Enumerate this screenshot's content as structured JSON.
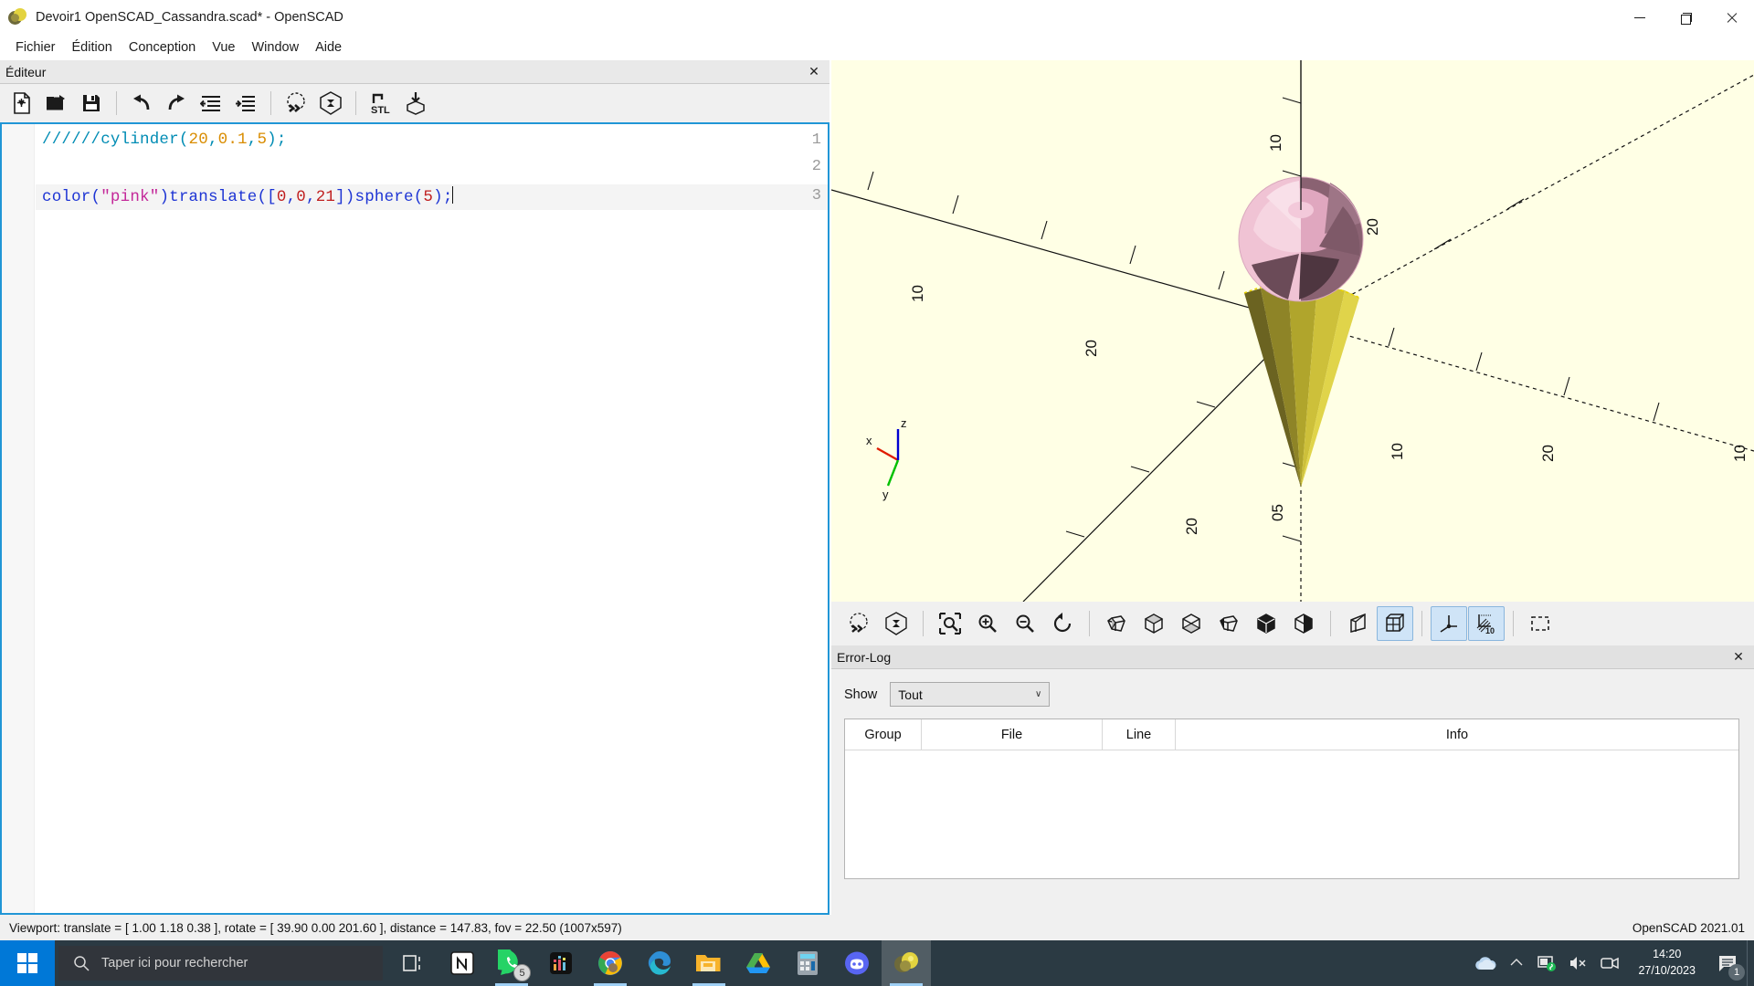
{
  "window": {
    "title": "Devoir1 OpenSCAD_Cassandra.scad* - OpenSCAD",
    "app_icon": "openscad-logo-icon",
    "controls": {
      "minimize": "minimize-button",
      "maximize": "maximize-button",
      "close": "close-button"
    }
  },
  "menubar": {
    "items": [
      {
        "label": "Fichier"
      },
      {
        "label": "Édition"
      },
      {
        "label": "Conception"
      },
      {
        "label": "Vue"
      },
      {
        "label": "Window"
      },
      {
        "label": "Aide"
      }
    ]
  },
  "editor": {
    "dock_title": "Éditeur",
    "close_label": "✕",
    "toolbar": [
      {
        "name": "new-file-icon",
        "tooltip": "Nouveau"
      },
      {
        "name": "open-file-icon",
        "tooltip": "Ouvrir"
      },
      {
        "name": "save-file-icon",
        "tooltip": "Enregistrer"
      },
      {
        "name": "undo-icon",
        "tooltip": "Annuler"
      },
      {
        "name": "redo-icon",
        "tooltip": "Rétablir"
      },
      {
        "name": "unindent-icon",
        "tooltip": "Désindenter"
      },
      {
        "name": "indent-icon",
        "tooltip": "Indenter"
      },
      {
        "name": "preview-icon",
        "tooltip": "Prévisualiser"
      },
      {
        "name": "render-icon",
        "tooltip": "Rendu"
      },
      {
        "name": "export-stl-icon",
        "tooltip": "Exporter STL",
        "text": "STL"
      },
      {
        "name": "export-image-icon",
        "tooltip": "Exporter image"
      }
    ],
    "lines": [
      {
        "number": "1",
        "text": "//////cylinder(20,0.1,5);"
      },
      {
        "number": "2",
        "text": ""
      },
      {
        "number": "3",
        "text": "color(\"pink\")translate([0,0,21])sphere(5);"
      }
    ],
    "line1_tokens": [
      {
        "t": "//////cylinder(",
        "c": "tok-comment"
      },
      {
        "t": "20",
        "c": "tok-num-c"
      },
      {
        "t": ",",
        "c": "tok-comment"
      },
      {
        "t": "0.1",
        "c": "tok-num-c"
      },
      {
        "t": ",",
        "c": "tok-comment"
      },
      {
        "t": "5",
        "c": "tok-num-c"
      },
      {
        "t": ");",
        "c": "tok-comment"
      }
    ],
    "line3_tokens": [
      {
        "t": "color",
        "c": "tok-fn"
      },
      {
        "t": "(",
        "c": "tok-punct"
      },
      {
        "t": "\"pink\"",
        "c": "tok-str"
      },
      {
        "t": ")",
        "c": "tok-punct"
      },
      {
        "t": "translate",
        "c": "tok-fn"
      },
      {
        "t": "([",
        "c": "tok-punct"
      },
      {
        "t": "0",
        "c": "tok-num"
      },
      {
        "t": ",",
        "c": "tok-punct"
      },
      {
        "t": "0",
        "c": "tok-num"
      },
      {
        "t": ",",
        "c": "tok-punct"
      },
      {
        "t": "21",
        "c": "tok-num"
      },
      {
        "t": "])",
        "c": "tok-punct"
      },
      {
        "t": "sphere",
        "c": "tok-fn"
      },
      {
        "t": "(",
        "c": "tok-punct"
      },
      {
        "t": "5",
        "c": "tok-num"
      },
      {
        "t": ");",
        "c": "tok-punct"
      }
    ],
    "cursor_line": "3"
  },
  "viewport": {
    "background_color": "#ffffe5",
    "model": {
      "cone_color": "#c3b42e",
      "sphere_color": "#f0b8cf",
      "description": "ice-cream cone: yellow cone apex-down with pink faceted sphere on top"
    },
    "axis_indicator": {
      "x_label": "x",
      "y_label": "y",
      "z_label": "z",
      "x_color": "#e01b00",
      "y_color": "#00c000",
      "z_color": "#0000d0"
    },
    "axis_tick_labels": [
      "10",
      "20",
      "10",
      "20",
      "10",
      "20",
      "10",
      "20",
      "10",
      "10",
      "10"
    ],
    "toolbar": [
      {
        "name": "preview-icon",
        "active": false
      },
      {
        "name": "render-icon",
        "active": false
      },
      {
        "name": "zoom-fit-icon",
        "active": false
      },
      {
        "name": "zoom-in-icon",
        "active": false
      },
      {
        "name": "zoom-out-icon",
        "active": false
      },
      {
        "name": "reset-view-icon",
        "active": false
      },
      {
        "name": "view-right-icon",
        "active": false
      },
      {
        "name": "view-top-icon",
        "active": false
      },
      {
        "name": "view-bottom-icon",
        "active": false
      },
      {
        "name": "view-left-icon",
        "active": false
      },
      {
        "name": "view-front-icon",
        "active": false
      },
      {
        "name": "view-back-icon",
        "active": false
      },
      {
        "name": "perspective-icon",
        "active": false
      },
      {
        "name": "orthogonal-icon",
        "active": true
      },
      {
        "name": "show-axes-icon",
        "active": true
      },
      {
        "name": "show-scale-icon",
        "active": true,
        "text": "10"
      },
      {
        "name": "show-edges-icon",
        "active": false
      }
    ]
  },
  "errorlog": {
    "dock_title": "Error-Log",
    "close_label": "✕",
    "show_label": "Show",
    "filter_value": "Tout",
    "filter_chevron": "∨",
    "columns": [
      "Group",
      "File",
      "Line",
      "Info"
    ],
    "rows": []
  },
  "statusbar": {
    "viewport_info": "Viewport: translate = [ 1.00 1.18 0.38 ], rotate = [ 39.90 0.00 201.60 ], distance = 147.83, fov = 22.50 (1007x597)",
    "version": "OpenSCAD 2021.01"
  },
  "taskbar": {
    "start_label": "start-button",
    "search": {
      "placeholder": "Taper ici pour rechercher",
      "icon": "search-icon"
    },
    "apps": [
      {
        "name": "task-view-icon",
        "label": "Task View"
      },
      {
        "name": "notion-icon",
        "label": "Notion"
      },
      {
        "name": "whatsapp-icon",
        "label": "WhatsApp",
        "badge": "5"
      },
      {
        "name": "spotify-icon",
        "label": "Spotify"
      },
      {
        "name": "chrome-icon",
        "label": "Google Chrome"
      },
      {
        "name": "edge-icon",
        "label": "Microsoft Edge"
      },
      {
        "name": "file-explorer-icon",
        "label": "Explorateur de fichiers"
      },
      {
        "name": "google-drive-icon",
        "label": "Google Drive"
      },
      {
        "name": "calculator-icon",
        "label": "Calculatrice"
      },
      {
        "name": "discord-icon",
        "label": "Discord"
      },
      {
        "name": "openscad-icon",
        "label": "OpenSCAD"
      }
    ],
    "tray": [
      {
        "name": "onedrive-icon"
      },
      {
        "name": "chevron-up-icon"
      },
      {
        "name": "network-icon"
      },
      {
        "name": "volume-muted-icon"
      },
      {
        "name": "camera-icon"
      }
    ],
    "clock": {
      "time": "14:20",
      "date": "27/10/2023"
    },
    "notifications": {
      "count": "1",
      "icon": "notification-icon"
    }
  }
}
